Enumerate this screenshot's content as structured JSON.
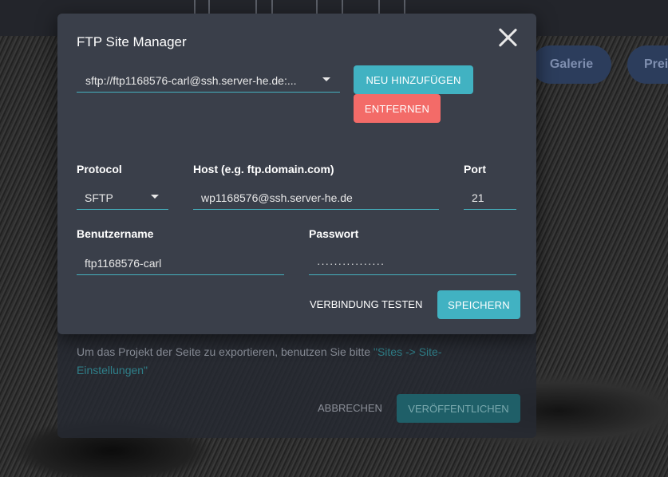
{
  "background": {
    "nav_pills": [
      "Galerie",
      "Prei"
    ],
    "export_text": "Um das Projekt der Seite zu exportieren, benutzen Sie bitte ",
    "export_link": "\"Sites -> Site-Einstellungen\"",
    "cancel_label": "ABBRECHEN",
    "publish_label": "VERÖFFENTLICHEN"
  },
  "dialog": {
    "title": "FTP Site Manager",
    "site_selected": "sftp://ftp1168576-carl@ssh.server-he.de:...",
    "add_label": "NEU HINZUFÜGEN",
    "remove_label": "ENTFERNEN",
    "protocol_label": "Protocol",
    "protocol_value": "SFTP",
    "host_label": "Host (e.g. ftp.domain.com)",
    "host_value": "wp1168576@ssh.server-he.de",
    "port_label": "Port",
    "port_value": "21",
    "username_label": "Benutzername",
    "username_value": "ftp1168576-carl",
    "password_label": "Passwort",
    "password_value": "················",
    "test_label": "VERBINDUNG TESTEN",
    "save_label": "SPEICHERN"
  },
  "colors": {
    "accent": "#41b2c2",
    "danger": "#f36b68",
    "dialog_bg": "#3a3f4a"
  }
}
